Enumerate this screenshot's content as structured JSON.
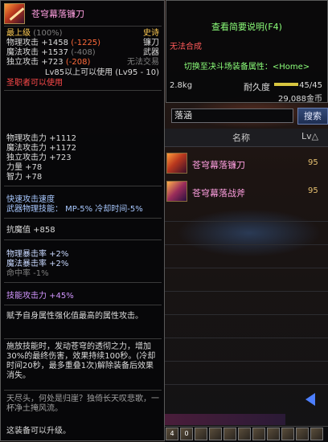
{
  "tooltip": {
    "item_name": "苍穹幕落镰刀",
    "rarity": "史诗",
    "grade": "最上级",
    "grade_pct": "(100%)",
    "category": "镰刀",
    "type": "武器",
    "trade": "无法交易",
    "base_stats": [
      {
        "label": "物理攻击",
        "value": "+1458",
        "diff": "(-1225)",
        "diff_color": "#ff6a3a"
      },
      {
        "label": "魔法攻击",
        "value": "+1537",
        "diff": "(-408)",
        "diff_color": "#7e7e7e"
      },
      {
        "label": "独立攻击",
        "value": "+723",
        "diff": "(-208)",
        "diff_color": "#ff6a3a"
      }
    ],
    "level_req": "Lv85以上可以使用 (Lv95 - 10)",
    "class_req": "圣职者可以使用",
    "stats": [
      "物理攻击力 +1112",
      "魔法攻击力 +1172",
      "独立攻击力 +723",
      "力量 +78",
      "智力 +78"
    ],
    "speed_title": "快速攻击速度",
    "weapon_skill": "武器物理技能： MP-5% 冷却时间-5%",
    "resist": "抗魔值 +858",
    "crit": [
      "物理暴击率 +2%",
      "魔法暴击率 +2%",
      "命中率 -1%"
    ],
    "skill_atk": "技能攻击力 +45%",
    "desc1": "赋予自身属性强化值最高的属性攻击。",
    "desc2": "施放技能时，发动苍穹的透彻之力，增加30%的最终伤害，效果持续100秒。(冷却时间20秒，最多重叠1次)解除装备后效果消失。",
    "flavor": "天尽头，何处是归崖？独倚长天叹悲歌，一杯净土掩风流。",
    "upgrade": "这装备可以升级。"
  },
  "panel2": {
    "view_desc": "查看简要说明(F4)",
    "cannot_synth": "无法合成",
    "switch_pvp": "切换至决斗场装备属性：<Home>",
    "weight": "2.8kg",
    "durability_label": "耐久度",
    "durability": "45/45",
    "price": "29,088金币"
  },
  "search": {
    "value": "落涵",
    "button": "搜索"
  },
  "list": {
    "col_name": "名称",
    "col_lv": "Lv△",
    "rows": [
      {
        "name": "苍穹幕落镰刀",
        "lv": "95"
      },
      {
        "name": "苍穹幕落战斧",
        "lv": "95"
      }
    ]
  },
  "skillbar": {
    "slots": [
      "4",
      "0",
      "",
      "",
      "",
      "",
      "",
      "",
      "",
      "",
      ""
    ]
  }
}
